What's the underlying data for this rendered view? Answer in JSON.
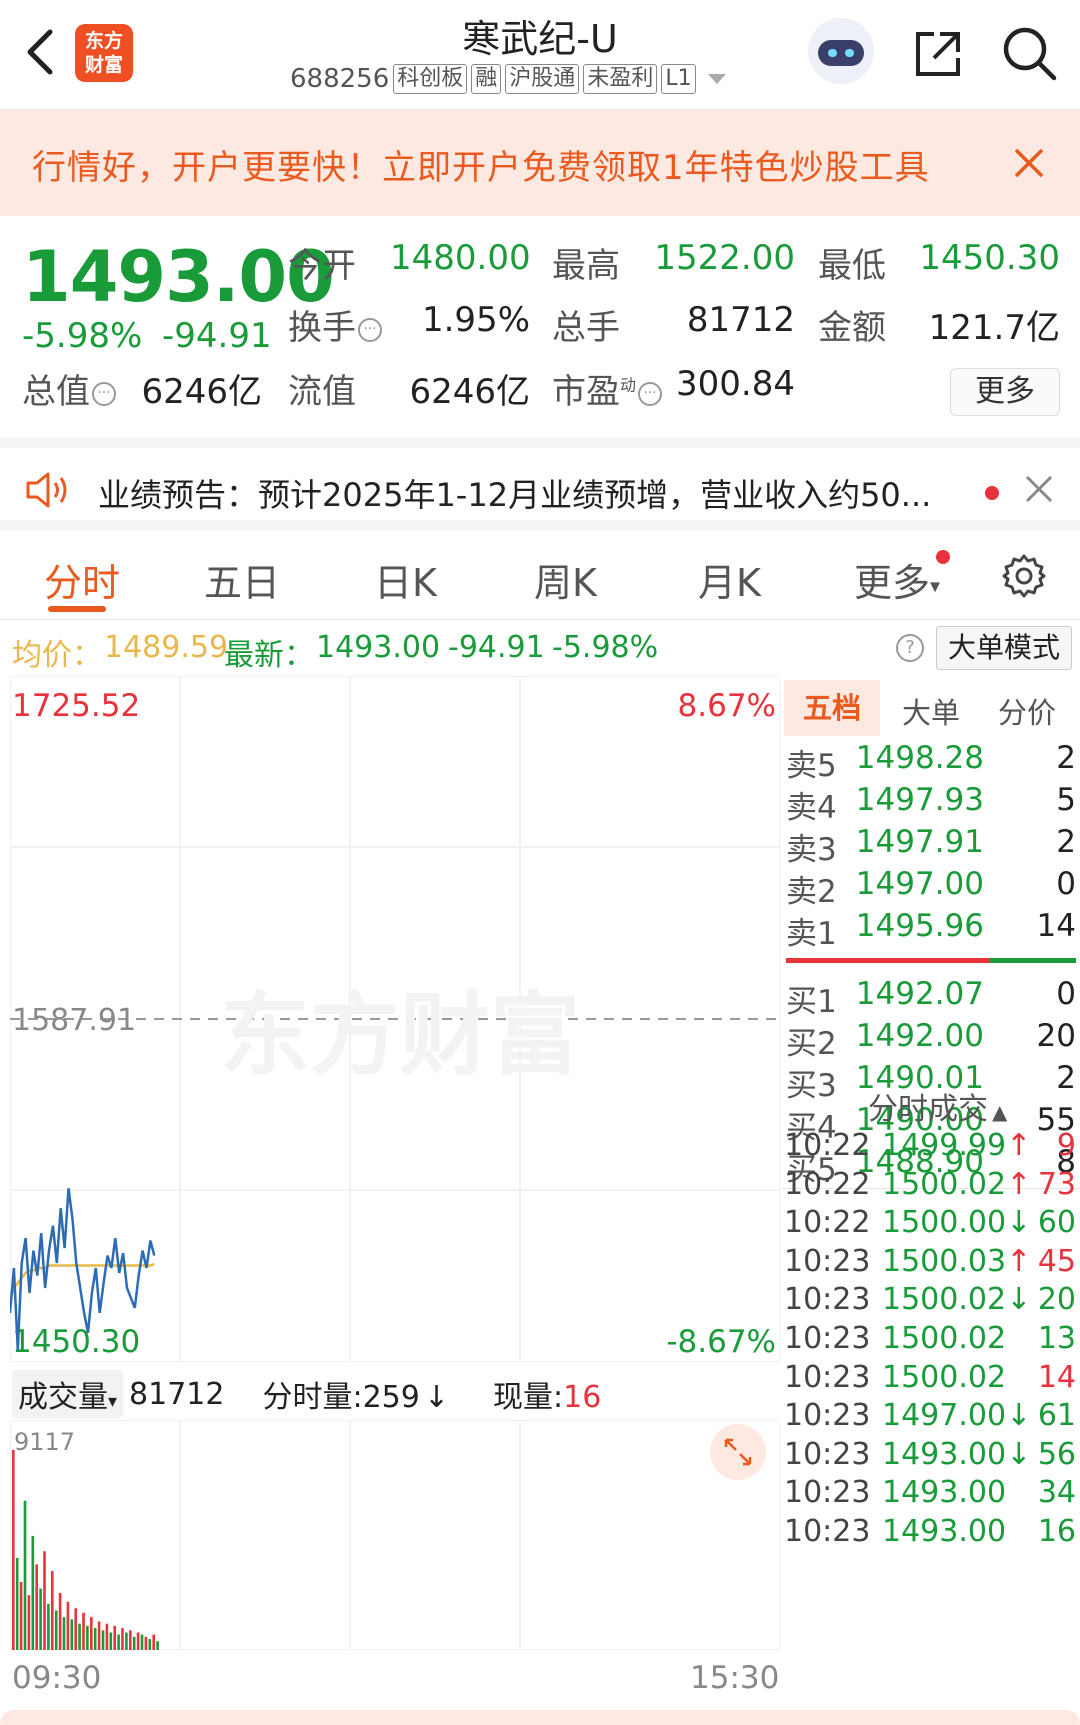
{
  "header": {
    "logo_line1": "东方",
    "logo_line2": "财富",
    "title": "寒武纪-U",
    "code": "688256",
    "tags": [
      "科创板",
      "融",
      "沪股通",
      "未盈利",
      "L1"
    ]
  },
  "banner": {
    "text": "行情好，开户更要快！立即开户免费领取1年特色炒股工具"
  },
  "quote": {
    "price": "1493.00",
    "pct": "-5.98%",
    "chg": "-94.91",
    "open_label": "今开",
    "open": "1480.00",
    "high_label": "最高",
    "high": "1522.00",
    "low_label": "最低",
    "low": "1450.30",
    "turnover_label": "换手",
    "turnover": "1.95%",
    "volume_label": "总手",
    "volume": "81712",
    "amount_label": "金额",
    "amount": "121.7亿",
    "mcap_label": "总值",
    "mcap": "6246亿",
    "float_label": "流值",
    "float": "6246亿",
    "pe_label": "市盈",
    "pe_sup": "动",
    "pe": "300.84",
    "more": "更多"
  },
  "notice": {
    "text": "业绩预告：预计2025年1-12月业绩预增，营业收入约50..."
  },
  "tabs": [
    "分时",
    "五日",
    "日K",
    "周K",
    "月K",
    "更多"
  ],
  "avg": {
    "avg_label": "均价：",
    "avg": "1489.59",
    "last_label": "最新：",
    "last": "1493.00",
    "chg": "-94.91",
    "pct": "-5.98%",
    "help": "?",
    "mode": "大单模式"
  },
  "chart": {
    "y_top": "1725.52",
    "y_mid": "1587.91",
    "y_bot": "1450.30",
    "pct_top": "8.67%",
    "pct_bot": "-8.67%",
    "watermark": "东方财富",
    "vol_label": "成交量",
    "vol_total": "81712",
    "vol_minute": "分时量:259",
    "vol_now_label": "现量:",
    "vol_now": "16",
    "vol_max": "9117",
    "time_start": "09:30",
    "time_end": "15:30"
  },
  "chart_data": {
    "type": "line",
    "title": "",
    "ylim": [
      1450.3,
      1725.52
    ],
    "prev_close": 1587.91,
    "series": [
      {
        "values": [
          1470,
          1488,
          1455,
          1490,
          1500,
          1478,
          1495,
          1485,
          1502,
          1480,
          1495,
          1505,
          1490,
          1512,
          1496,
          1520,
          1508,
          1490,
          1480,
          1470,
          1462,
          1478,
          1488,
          1470,
          1482,
          1493,
          1488,
          1500,
          1486,
          1494,
          1480,
          1476,
          1472,
          1485,
          1495,
          1488,
          1499,
          1493
        ]
      },
      {
        "values": [
          1475,
          1480,
          1482,
          1484,
          1486,
          1487,
          1487,
          1488,
          1488,
          1488,
          1489,
          1489,
          1489,
          1489,
          1489,
          1489,
          1489,
          1489,
          1489,
          1489,
          1489,
          1489,
          1489,
          1489,
          1489,
          1489,
          1489,
          1489,
          1489,
          1489,
          1489,
          1489,
          1489,
          1489,
          1489,
          1489,
          1489,
          1489.59
        ]
      }
    ],
    "volume": [
      9117,
      4200,
      3100,
      6800,
      2500,
      5200,
      3900,
      2800,
      4500,
      2100,
      3600,
      1800,
      2600,
      1500,
      2200,
      1400,
      1900,
      1200,
      1700,
      1100,
      1500,
      1000,
      1300,
      900,
      1200,
      800,
      1100,
      700,
      1000,
      800,
      900,
      600,
      800,
      700,
      600,
      500,
      700,
      400
    ]
  },
  "right_panel": {
    "tabs": [
      "五档",
      "大单",
      "分价"
    ],
    "asks": [
      {
        "label": "卖5",
        "price": "1498.28",
        "vol": "2"
      },
      {
        "label": "卖4",
        "price": "1497.93",
        "vol": "5"
      },
      {
        "label": "卖3",
        "price": "1497.91",
        "vol": "2"
      },
      {
        "label": "卖2",
        "price": "1497.00",
        "vol": "0"
      },
      {
        "label": "卖1",
        "price": "1495.96",
        "vol": "14"
      }
    ],
    "bids": [
      {
        "label": "买1",
        "price": "1492.07",
        "vol": "0"
      },
      {
        "label": "买2",
        "price": "1492.00",
        "vol": "20"
      },
      {
        "label": "买3",
        "price": "1490.01",
        "vol": "2"
      },
      {
        "label": "买4",
        "price": "1490.00",
        "vol": "55"
      },
      {
        "label": "买5",
        "price": "1488.90",
        "vol": "8"
      }
    ],
    "trades_header": "分时成交",
    "trades": [
      {
        "time": "10:22",
        "price": "1499.99",
        "arrow": "↑",
        "vol": "9",
        "color": "#e8323c"
      },
      {
        "time": "10:22",
        "price": "1500.02",
        "arrow": "↑",
        "vol": "73",
        "color": "#e8323c"
      },
      {
        "time": "10:22",
        "price": "1500.00",
        "arrow": "↓",
        "vol": "60",
        "color": "#1a9b3a"
      },
      {
        "time": "10:23",
        "price": "1500.03",
        "arrow": "↑",
        "vol": "45",
        "color": "#e8323c"
      },
      {
        "time": "10:23",
        "price": "1500.02",
        "arrow": "↓",
        "vol": "20",
        "color": "#1a9b3a"
      },
      {
        "time": "10:23",
        "price": "1500.02",
        "arrow": "",
        "vol": "13",
        "color": "#1a9b3a"
      },
      {
        "time": "10:23",
        "price": "1500.02",
        "arrow": "",
        "vol": "14",
        "color": "#e8323c"
      },
      {
        "time": "10:23",
        "price": "1497.00",
        "arrow": "↓",
        "vol": "61",
        "color": "#1a9b3a"
      },
      {
        "time": "10:23",
        "price": "1493.00",
        "arrow": "↓",
        "vol": "56",
        "color": "#1a9b3a"
      },
      {
        "time": "10:23",
        "price": "1493.00",
        "arrow": "",
        "vol": "34",
        "color": "#1a9b3a"
      },
      {
        "time": "10:23",
        "price": "1493.00",
        "arrow": "",
        "vol": "16",
        "color": "#1a9b3a"
      }
    ]
  },
  "colors": {
    "up": "#e8323c",
    "down": "#1a9b3a",
    "accent": "#ea5a1e",
    "price_line": "#2d6cb5",
    "avg_line": "#e8b84a"
  }
}
